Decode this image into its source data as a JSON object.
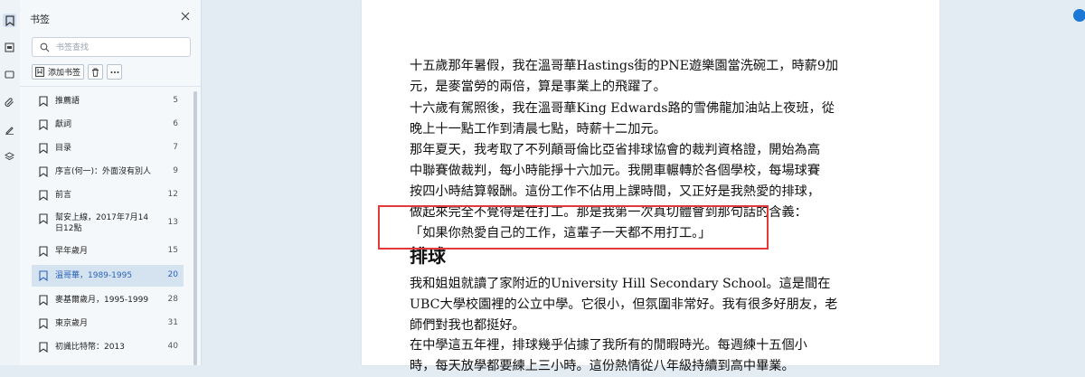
{
  "panel": {
    "title": "书签",
    "search_placeholder": "书签查找",
    "add_button_label": "添加书签"
  },
  "bookmarks": [
    {
      "label": "推薦語",
      "page": "5"
    },
    {
      "label": "獻詞",
      "page": "6"
    },
    {
      "label": "目录",
      "page": "7"
    },
    {
      "label": "序言(何一)：外面沒有別人",
      "page": "9"
    },
    {
      "label": "前言",
      "page": "12"
    },
    {
      "label": "幫安上線，2017年7月14日12點",
      "page": "13"
    },
    {
      "label": "早年歲月",
      "page": "15"
    },
    {
      "label": "溫哥華，1989-1995",
      "page": "20",
      "active": true
    },
    {
      "label": "麥基爾歲月，1995-1999",
      "page": "28"
    },
    {
      "label": "東京歲月",
      "page": "31"
    },
    {
      "label": "初識比特幣：2013",
      "page": "40"
    }
  ],
  "document": {
    "p1": "十五歲那年暑假，我在溫哥華Hastings街的PNE遊樂園當洗碗工，時薪9加\n元，是麥當勞的兩倍，算是事業上的飛躍了。",
    "p2": "十六歲有駕照後，我在溫哥華King Edwards路的雪佛龍加油站上夜班，從\n晚上十一點工作到清晨七點，時薪十二加元。",
    "p3": "那年夏天，我考取了不列顛哥倫比亞省排球協會的裁判資格證，開始為高\n中聯賽做裁判，每小時能掙十六加元。我開車輾轉於各個學校，每場球賽\n按四小時結算報酬。這份工作不佔用上課時間，又正好是我熱愛的排球，\n做起來完全不覺得是在打工。那是我第一次真切體會到那句話的含義：\n「如果你熱愛自己的工作，這輩子一天都不用打工。」",
    "heading": "排球",
    "p4": "我和姐姐就讀了家附近的University Hill Secondary School。這是間在\nUBC大學校園裡的公立中學。它很小，但氛圍非常好。我有很多好朋友，老\n師們對我也都挺好。",
    "p5": "在中學這五年裡，排球幾乎佔據了我所有的閒暇時光。每週練十五個小\n時，每天放學都要練上三小時。這份熱情從八年級持續到高中畢業。"
  },
  "colors": {
    "accent": "#2b65b8",
    "highlight_box": "#e23a3a",
    "active_row": "#d5e2f0"
  }
}
